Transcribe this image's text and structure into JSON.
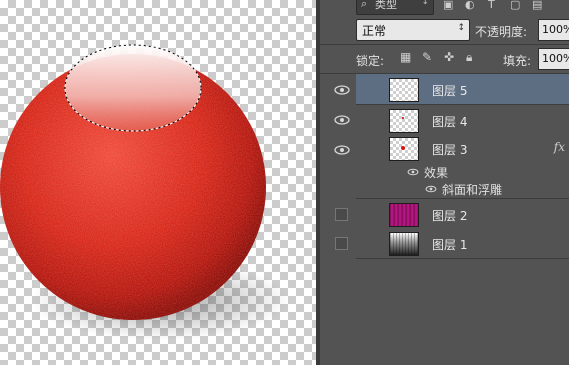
{
  "panel": {
    "kind_filter": "类型",
    "blend_mode": "正常",
    "opacity_label": "不透明度:",
    "opacity_value": "100%",
    "lock_label": "锁定:",
    "fill_label": "填充:",
    "fill_value": "100%"
  },
  "layers": [
    {
      "name": "图层 5",
      "selected": true,
      "visible": true
    },
    {
      "name": "图层 4",
      "selected": false,
      "visible": true
    },
    {
      "name": "图层 3",
      "selected": false,
      "visible": true,
      "fx": "fx",
      "effects_label": "效果",
      "effect_item": "斜面和浮雕"
    },
    {
      "name": "图层 2",
      "selected": false,
      "visible": false
    },
    {
      "name": "图层 1",
      "selected": false,
      "visible": false
    }
  ],
  "colors": {
    "panel_bg": "#535353",
    "selected_row": "#5d6d82",
    "sphere_red": "#e0301f",
    "layer2_thumb": "#b0127a"
  }
}
